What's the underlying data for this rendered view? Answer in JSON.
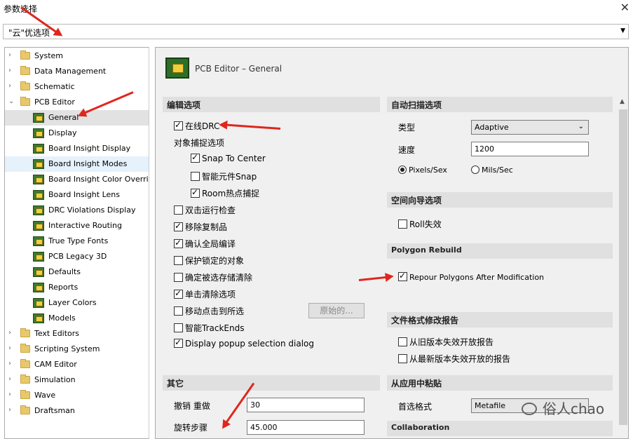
{
  "window": {
    "title": "参数选择",
    "close_glyph": "✕"
  },
  "preset_combo": {
    "value": "\"云\"优选项"
  },
  "tree": [
    {
      "label": "System",
      "kind": "folder",
      "expander": "›"
    },
    {
      "label": "Data Management",
      "kind": "folder",
      "expander": "›"
    },
    {
      "label": "Schematic",
      "kind": "folder",
      "expander": "›"
    },
    {
      "label": "PCB Editor",
      "kind": "folder-open",
      "expander": "⌄"
    },
    {
      "label": "General",
      "kind": "page",
      "selected": true
    },
    {
      "label": "Display",
      "kind": "page"
    },
    {
      "label": "Board Insight Display",
      "kind": "page"
    },
    {
      "label": "Board Insight Modes",
      "kind": "page",
      "hover": true
    },
    {
      "label": "Board Insight Color Overrides",
      "kind": "page"
    },
    {
      "label": "Board Insight Lens",
      "kind": "page"
    },
    {
      "label": "DRC Violations Display",
      "kind": "page"
    },
    {
      "label": "Interactive Routing",
      "kind": "page"
    },
    {
      "label": "True Type Fonts",
      "kind": "page"
    },
    {
      "label": "PCB Legacy 3D",
      "kind": "page"
    },
    {
      "label": "Defaults",
      "kind": "page"
    },
    {
      "label": "Reports",
      "kind": "page"
    },
    {
      "label": "Layer Colors",
      "kind": "page"
    },
    {
      "label": "Models",
      "kind": "page"
    },
    {
      "label": "Text Editors",
      "kind": "folder",
      "expander": "›"
    },
    {
      "label": "Scripting System",
      "kind": "folder",
      "expander": "›"
    },
    {
      "label": "CAM Editor",
      "kind": "folder",
      "expander": "›"
    },
    {
      "label": "Simulation",
      "kind": "folder",
      "expander": "›"
    },
    {
      "label": "Wave",
      "kind": "folder",
      "expander": "›"
    },
    {
      "label": "Draftsman",
      "kind": "folder",
      "expander": "›"
    }
  ],
  "panel": {
    "header": "PCB Editor – General",
    "edit_options": {
      "title": "编辑选项",
      "online_drc": {
        "label": "在线DRC",
        "checked": true
      },
      "snap_group": "对象捕捉选项",
      "snap_to_center": {
        "label": "Snap To Center",
        "checked": true
      },
      "smart_snap": {
        "label": "智能元件Snap",
        "checked": false
      },
      "room_snap": {
        "label": "Room热点捕捉",
        "checked": true
      },
      "dblclick_check": {
        "label": "双击运行检查",
        "checked": false
      },
      "remove_dup": {
        "label": "移除复制品",
        "checked": true
      },
      "confirm_global": {
        "label": "确认全局编译",
        "checked": true
      },
      "protect_locked": {
        "label": "保护锁定的对象",
        "checked": false
      },
      "confirm_sel_clear": {
        "label": "确定被选存储清除",
        "checked": false
      },
      "click_clear": {
        "label": "单击清除选项",
        "checked": true
      },
      "move_click": {
        "label": "移动点击到所选",
        "checked": false
      },
      "original_btn": "原始的...",
      "smart_trackends": {
        "label": "智能TrackEnds",
        "checked": false
      },
      "popup_dialog": {
        "label": "Display popup selection dialog",
        "checked": true
      }
    },
    "other": {
      "title": "其它",
      "undo_label": "撤销 重做",
      "undo_value": "30",
      "rotate_label": "旋转步骤",
      "rotate_value": "45.000"
    },
    "autopan": {
      "title": "自动扫描选项",
      "type_label": "类型",
      "type_value": "Adaptive",
      "speed_label": "速度",
      "speed_value": "1200",
      "pixels": {
        "label": "Pixels/Sex",
        "selected": true
      },
      "mils": {
        "label": "Mils/Sec",
        "selected": false
      }
    },
    "space_nav": {
      "title": "空间向导选项",
      "roll": {
        "label": "Roll失效",
        "checked": false
      }
    },
    "polygon": {
      "title": "Polygon Rebuild",
      "repour": {
        "label": "Repour Polygons After Modification",
        "checked": true
      }
    },
    "file_format": {
      "title": "文件格式修改报告",
      "old": {
        "label": "从旧版本失效开放报告",
        "checked": false
      },
      "new": {
        "label": "从最新版本失效开放的报告",
        "checked": false
      }
    },
    "paste": {
      "title": "从应用中粘贴",
      "pref_label": "首选格式",
      "pref_value": "Metafile"
    },
    "collab": {
      "title": "Collaboration"
    }
  },
  "watermark": "俗人chao",
  "colors": {
    "annotation_arrow": "#e0261d",
    "section_bg": "#e0e0e0"
  }
}
